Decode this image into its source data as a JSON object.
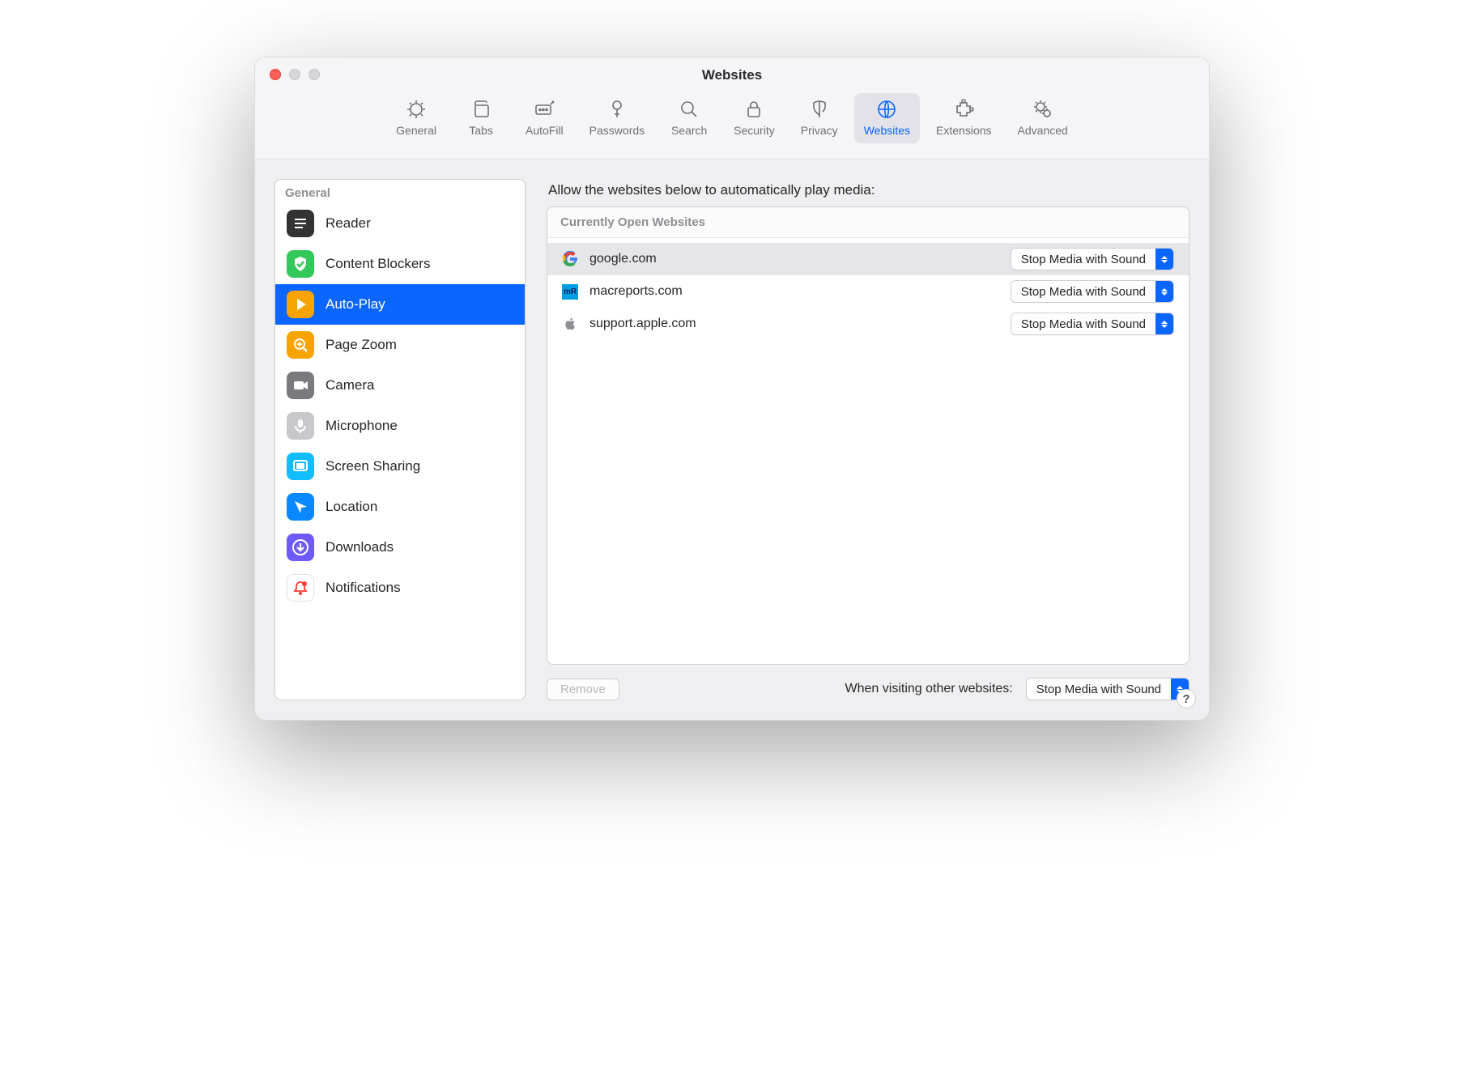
{
  "window": {
    "title": "Websites"
  },
  "toolbar": {
    "items": [
      {
        "id": "general",
        "label": "General"
      },
      {
        "id": "tabs",
        "label": "Tabs"
      },
      {
        "id": "autofill",
        "label": "AutoFill"
      },
      {
        "id": "passwords",
        "label": "Passwords"
      },
      {
        "id": "search",
        "label": "Search"
      },
      {
        "id": "security",
        "label": "Security"
      },
      {
        "id": "privacy",
        "label": "Privacy"
      },
      {
        "id": "websites",
        "label": "Websites",
        "active": true
      },
      {
        "id": "extensions",
        "label": "Extensions"
      },
      {
        "id": "advanced",
        "label": "Advanced"
      }
    ]
  },
  "sidebar": {
    "section_label": "General",
    "items": [
      {
        "id": "reader",
        "label": "Reader",
        "icon": "list",
        "bg": "#333"
      },
      {
        "id": "blockers",
        "label": "Content Blockers",
        "icon": "shield",
        "bg": "#32c85a"
      },
      {
        "id": "autoplay",
        "label": "Auto-Play",
        "icon": "play",
        "bg": "#f7a400",
        "selected": true
      },
      {
        "id": "zoom",
        "label": "Page Zoom",
        "icon": "zoom",
        "bg": "#f7a400"
      },
      {
        "id": "camera",
        "label": "Camera",
        "icon": "camera",
        "bg": "#7a7a7e"
      },
      {
        "id": "mic",
        "label": "Microphone",
        "icon": "mic",
        "bg": "#c7c7cc"
      },
      {
        "id": "screen",
        "label": "Screen Sharing",
        "icon": "screen",
        "bg": "#11bcff"
      },
      {
        "id": "location",
        "label": "Location",
        "icon": "location",
        "bg": "#0a88ff"
      },
      {
        "id": "downloads",
        "label": "Downloads",
        "icon": "download",
        "bg": "#6d5af9"
      },
      {
        "id": "notifications",
        "label": "Notifications",
        "icon": "bell",
        "bg": "#ffffff",
        "fg": "#ff3b30"
      }
    ]
  },
  "main": {
    "prompt": "Allow the websites below to automatically play media:",
    "list_header": "Currently Open Websites",
    "rows": [
      {
        "domain": "google.com",
        "icon": "google",
        "setting": "Stop Media with Sound",
        "selected": true
      },
      {
        "domain": "macreports.com",
        "icon": "mr",
        "setting": "Stop Media with Sound"
      },
      {
        "domain": "support.apple.com",
        "icon": "apple",
        "setting": "Stop Media with Sound"
      }
    ],
    "remove_label": "Remove",
    "remove_enabled": false,
    "other_label": "When visiting other websites:",
    "other_setting": "Stop Media with Sound"
  },
  "help_label": "?"
}
